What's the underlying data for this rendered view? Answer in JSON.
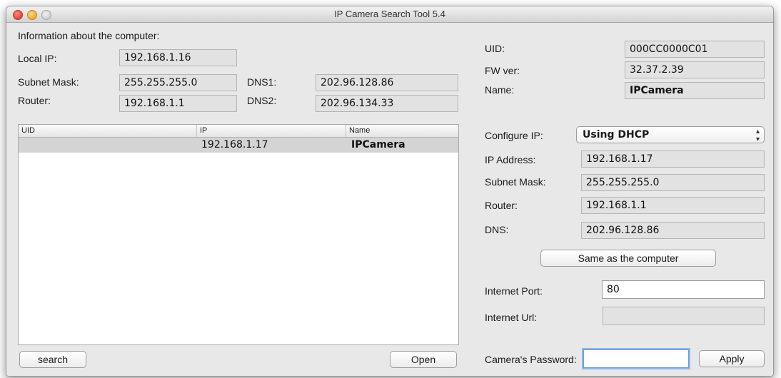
{
  "window": {
    "title": "IP Camera Search Tool 5.4"
  },
  "computer": {
    "header": "Information about the computer:",
    "local_ip_label": "Local IP:",
    "local_ip": "192.168.1.16",
    "subnet_label": "Subnet Mask:",
    "subnet": "255.255.255.0",
    "router_label": "Router:",
    "router": "192.168.1.1",
    "dns1_label": "DNS1:",
    "dns1": "202.96.128.86",
    "dns2_label": "DNS2:",
    "dns2": "202.96.134.33"
  },
  "table": {
    "columns": [
      "UID",
      "IP",
      "Name"
    ],
    "rows": [
      {
        "uid": "",
        "ip": "192.168.1.17",
        "name": "IPCamera"
      }
    ]
  },
  "device": {
    "uid_label": "UID:",
    "uid": "000CC0000C01",
    "fw_label": "FW ver:",
    "fw": "32.37.2.39",
    "name_label": "Name:",
    "name": "IPCamera"
  },
  "config": {
    "configure_label": "Configure IP:",
    "configure_value": "Using DHCP",
    "ip_label": "IP Address:",
    "ip": "192.168.1.17",
    "subnet_label": "Subnet Mask:",
    "subnet": "255.255.255.0",
    "router_label": "Router:",
    "router": "192.168.1.1",
    "dns_label": "DNS:",
    "dns": "202.96.128.86",
    "same_button": "Same as the computer",
    "port_label": "Internet Port:",
    "port": "80",
    "url_label": "Internet Url:",
    "url": "",
    "password_label": "Camera's Password:",
    "password": "",
    "apply_button": "Apply"
  },
  "buttons": {
    "search": "search",
    "open": "Open"
  },
  "icons": {
    "close": "close-window-icon",
    "minimize": "minimize-window-icon",
    "maximize": "maximize-window-icon",
    "select_arrows": "up-down-arrows-icon"
  },
  "colors": {
    "window_bg": "#e8e8e8",
    "field_bg": "#e2e2e2",
    "selected_row": "#d4d4d4",
    "focus_ring": "#8db7ea",
    "close": "#e0443a",
    "minimize": "#f0a92e"
  }
}
